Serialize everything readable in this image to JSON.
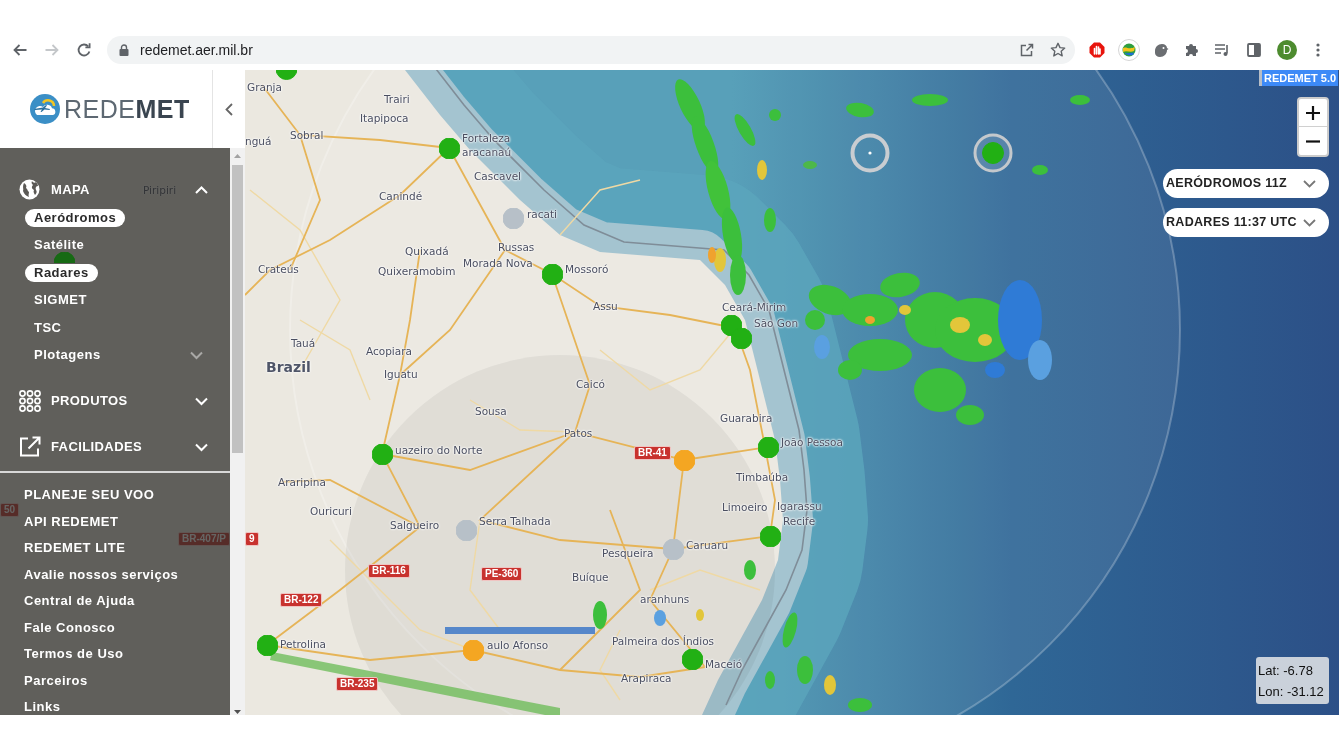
{
  "browser": {
    "nav_buttons": [
      {
        "kind": "back",
        "disabled": false
      },
      {
        "kind": "forward",
        "disabled": true
      },
      {
        "kind": "reload",
        "disabled": false
      }
    ],
    "url": "redemet.aer.mil.br",
    "profile_initial": "D"
  },
  "sidebar": {
    "logo": "REDE**MET**",
    "sections": [
      {
        "kind": "map",
        "label": "MAPA",
        "expanded": true,
        "items": [
          {
            "label": "Aeródromos",
            "selected": true,
            "has_submenu": false
          },
          {
            "label": "Satélite",
            "selected": false,
            "has_submenu": false
          },
          {
            "label": "Radares",
            "selected": true,
            "has_submenu": false
          },
          {
            "label": "SIGMET",
            "selected": false,
            "has_submenu": false
          },
          {
            "label": "TSC",
            "selected": false,
            "has_submenu": false
          },
          {
            "label": "Plotagens",
            "selected": false,
            "has_submenu": true
          }
        ]
      },
      {
        "kind": "products",
        "label": "PRODUTOS",
        "expanded": false
      },
      {
        "kind": "facilities",
        "label": "FACILIDADES",
        "expanded": false
      }
    ],
    "links": [
      "PLANEJE SEU VOO",
      "API REDEMET",
      "REDEMET LITE",
      "Avalie nossos serviços",
      "Central de Ajuda",
      "Fale Conosco",
      "Termos de Uso",
      "Parceiros",
      "Links"
    ]
  },
  "map": {
    "version": "REDEMET 5.0",
    "layers": [
      {
        "label": "AERÓDROMOS 11Z"
      },
      {
        "label": "RADARES 11:37 UTC"
      }
    ],
    "coordinates": [
      "Lat: -6.78",
      "Lon: -31.12"
    ],
    "labels": [
      {
        "kind": "city",
        "text": "Granja"
      },
      {
        "kind": "city",
        "text": "Trairi"
      },
      {
        "kind": "city",
        "text": "Itapipoca"
      },
      {
        "kind": "city",
        "text": "nguá"
      },
      {
        "kind": "city",
        "text": "Sobral"
      },
      {
        "kind": "city",
        "text": "Fortaleza"
      },
      {
        "kind": "city",
        "text": "aracanaú"
      },
      {
        "kind": "city",
        "text": "Cascavel"
      },
      {
        "kind": "city",
        "text": "Piripiri"
      },
      {
        "kind": "city",
        "text": "Canindé"
      },
      {
        "kind": "city",
        "text": "racati"
      },
      {
        "kind": "city",
        "text": "Quixadá"
      },
      {
        "kind": "city",
        "text": "Russas"
      },
      {
        "kind": "city",
        "text": "Crateús"
      },
      {
        "kind": "city",
        "text": "Quixeramobim"
      },
      {
        "kind": "city",
        "text": "Morada Nova"
      },
      {
        "kind": "city",
        "text": "Mossoró"
      },
      {
        "kind": "city",
        "text": "Assu"
      },
      {
        "kind": "city",
        "text": "Ceará-Mirim"
      },
      {
        "kind": "city",
        "text": "São Gon"
      },
      {
        "kind": "city",
        "text": "Tauá"
      },
      {
        "kind": "city",
        "text": "Acopiara"
      },
      {
        "kind": "country",
        "text": "Brazil"
      },
      {
        "kind": "city",
        "text": "Iguatu"
      },
      {
        "kind": "city",
        "text": "Caicó"
      },
      {
        "kind": "city",
        "text": "Sousa"
      },
      {
        "kind": "city",
        "text": "Guarabira"
      },
      {
        "kind": "city",
        "text": "Patos"
      },
      {
        "kind": "city",
        "text": "uazeiro do Norte"
      },
      {
        "kind": "road",
        "text": "BR-41"
      },
      {
        "kind": "city",
        "text": "João Pessoa"
      },
      {
        "kind": "city",
        "text": "Araripina"
      },
      {
        "kind": "city",
        "text": "Timbaúba"
      },
      {
        "kind": "road",
        "text": "50"
      },
      {
        "kind": "city",
        "text": "Ouricuri"
      },
      {
        "kind": "city",
        "text": "Limoeiro"
      },
      {
        "kind": "city",
        "text": "Igarassu"
      },
      {
        "kind": "city",
        "text": "Salgueiro"
      },
      {
        "kind": "city",
        "text": "Serra Talhada"
      },
      {
        "kind": "city",
        "text": "Recife"
      },
      {
        "kind": "road",
        "text": "BR-407/P"
      },
      {
        "kind": "road",
        "text": "9"
      },
      {
        "kind": "city",
        "text": "Pesqueira"
      },
      {
        "kind": "city",
        "text": "Caruaru"
      },
      {
        "kind": "road",
        "text": "BR-116"
      },
      {
        "kind": "road",
        "text": "PE-360"
      },
      {
        "kind": "city",
        "text": "Buíque"
      },
      {
        "kind": "road",
        "text": "BR-122"
      },
      {
        "kind": "city",
        "text": "aranhuns"
      },
      {
        "kind": "city",
        "text": "Petrolina"
      },
      {
        "kind": "city",
        "text": "aulo Afonso"
      },
      {
        "kind": "city",
        "text": "Palmeira dos Índios"
      },
      {
        "kind": "city",
        "text": "Maceió"
      },
      {
        "kind": "road",
        "text": "BR-235"
      },
      {
        "kind": "city",
        "text": "Arapiraca"
      }
    ],
    "markers": [
      {
        "kind": "sphere",
        "color": "#22b014",
        "halo": false
      },
      {
        "kind": "sphere",
        "color": "#22b014",
        "halo": false
      },
      {
        "kind": "sphere",
        "color": "#b7c0c8",
        "halo": false
      },
      {
        "kind": "sphere",
        "color": "#22b014",
        "halo": false
      },
      {
        "kind": "sphere",
        "color": "#22b014",
        "halo": false
      },
      {
        "kind": "sphere",
        "color": "#22b014",
        "halo": false
      },
      {
        "kind": "sphere",
        "color": "#22b014",
        "halo": false
      },
      {
        "kind": "sphere",
        "color": "#f4a622",
        "halo": false
      },
      {
        "kind": "sphere",
        "color": "#22b014",
        "halo": false
      },
      {
        "kind": "sphere",
        "color": "#b7c0c8",
        "halo": false
      },
      {
        "kind": "sphere",
        "color": "#b7c0c8",
        "halo": false
      },
      {
        "kind": "sphere",
        "color": "#22b014",
        "halo": false
      },
      {
        "kind": "sphere",
        "color": "#22b014",
        "halo": false
      },
      {
        "kind": "sphere",
        "color": "#f4a622",
        "halo": false
      },
      {
        "kind": "sphere",
        "color": "#22b014",
        "halo": false
      },
      {
        "kind": "ring",
        "color": "#c9cdd1",
        "halo": false
      },
      {
        "kind": "sphere",
        "color": "#22b014",
        "halo": true
      },
      {
        "kind": "sphere",
        "color": "#176a14",
        "halo": false
      }
    ]
  }
}
